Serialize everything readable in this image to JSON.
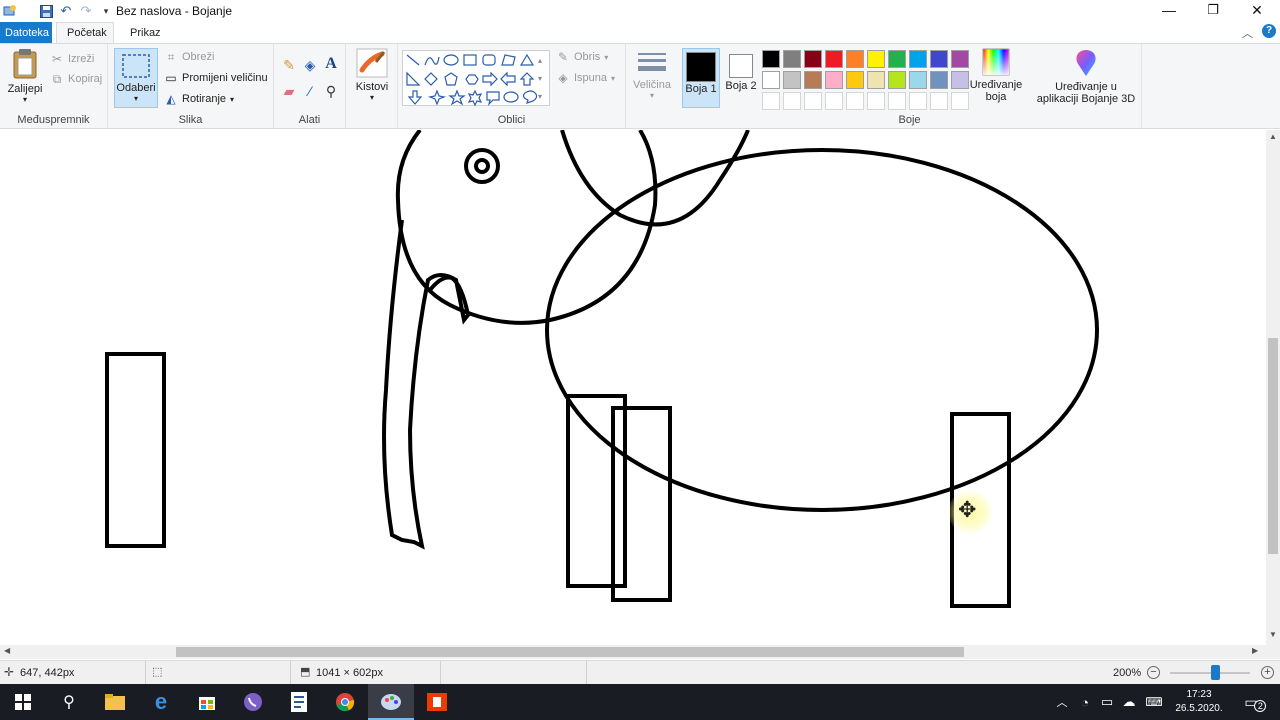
{
  "window": {
    "title": "Bez naslova - Bojanje",
    "minimize": "—",
    "maximize": "❐",
    "close": "✕"
  },
  "tabs": {
    "file": "Datoteka",
    "home": "Početak",
    "view": "Prikaz"
  },
  "clipboard": {
    "paste": "Zalijepi",
    "cut": "Izreži",
    "copy": "Kopiraj",
    "label": "Međuspremnik"
  },
  "image": {
    "select": "Odaberi",
    "crop": "Obreži",
    "resize": "Promijeni veličinu",
    "rotate": "Rotiranje",
    "label": "Slika"
  },
  "tools": {
    "label": "Alati"
  },
  "brushes": {
    "label": "Kistovi"
  },
  "shapes": {
    "outline": "Obris",
    "fill": "Ispuna",
    "label": "Oblici"
  },
  "size": {
    "label": "Veličina"
  },
  "colors": {
    "color1_label": "Boja 1",
    "color2_label": "Boja 2",
    "edit_colors": "Uređivanje boja",
    "edit_3d": "Uređivanje u aplikaciji Bojanje 3D",
    "label": "Boje",
    "color1": "#000000",
    "color2": "#ffffff",
    "palette_row1": [
      "#000000",
      "#7f7f7f",
      "#880015",
      "#ed1c24",
      "#ff7f27",
      "#fff200",
      "#22b14c",
      "#00a2e8",
      "#3f48cc",
      "#a349a4"
    ],
    "palette_row2": [
      "#ffffff",
      "#c3c3c3",
      "#b97a57",
      "#ffaec9",
      "#ffc90e",
      "#efe4b0",
      "#b5e61d",
      "#99d9ea",
      "#7092be",
      "#c8bfe7"
    ]
  },
  "status": {
    "cursor_pos": "647, 442px",
    "image_size": "1041 × 602px",
    "zoom": "200%"
  },
  "taskbar": {
    "time": "17:23",
    "date": "26.5.2020.",
    "notifications": "2"
  }
}
